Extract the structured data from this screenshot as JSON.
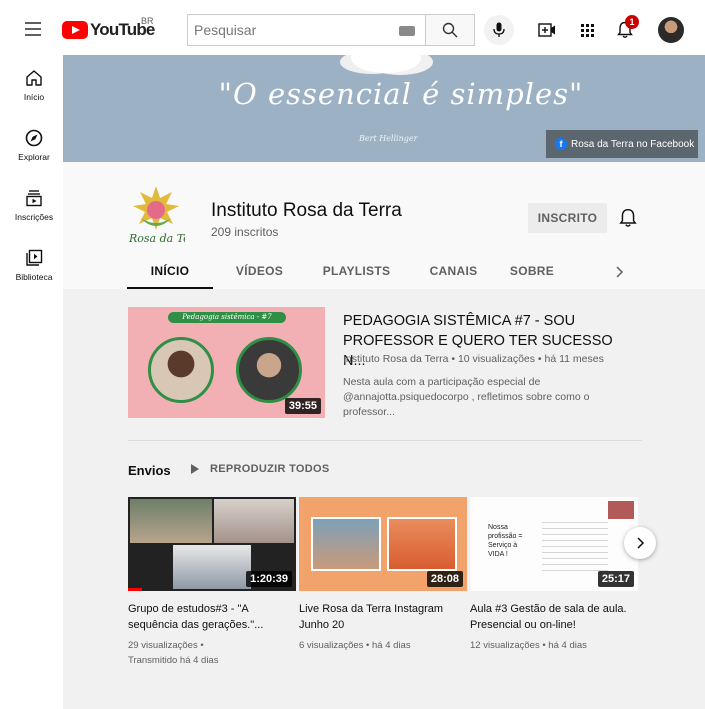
{
  "header": {
    "logo_text": "YouTube",
    "country_code": "BR",
    "search_placeholder": "Pesquisar",
    "notification_count": "1"
  },
  "sidebar": {
    "items": [
      {
        "label": "Início",
        "icon": "home-icon"
      },
      {
        "label": "Explorar",
        "icon": "compass-icon"
      },
      {
        "label": "Inscrições",
        "icon": "subscriptions-icon"
      },
      {
        "label": "Biblioteca",
        "icon": "library-icon"
      }
    ]
  },
  "banner": {
    "quote": "\"O essencial é simples\"",
    "author": "Bert Hellinger",
    "facebook_link": "Rosa da Terra no Facebook"
  },
  "channel": {
    "name": "Instituto Rosa da Terra",
    "subscribers": "209 inscritos",
    "subscribe_label": "INSCRITO",
    "logo_text": "Rosa da Terra"
  },
  "tabs": [
    {
      "label": "INÍCIO",
      "active": true
    },
    {
      "label": "VÍDEOS",
      "active": false
    },
    {
      "label": "PLAYLISTS",
      "active": false
    },
    {
      "label": "CANAIS",
      "active": false
    },
    {
      "label": "SOBRE",
      "active": false
    }
  ],
  "featured": {
    "thumb_banner": "Pedagogia sistêmica - #7",
    "duration": "39:55",
    "title": "PEDAGOGIA SISTÊMICA #7 - SOU PROFESSOR E QUERO TER SUCESSO N...",
    "meta": "Instituto Rosa da Terra • 10 visualizações • há 11 meses",
    "description": "Nesta aula com a participação especial de @annajotta.psiquedocorpo , refletimos sobre como o professor..."
  },
  "shelf": {
    "title": "Envios",
    "play_all": "REPRODUZIR TODOS",
    "videos": [
      {
        "title": "Grupo de estudos#3 - \"A sequência das gerações.\"...",
        "meta1": "29 visualizações •",
        "meta2": "Transmitido há 4 dias",
        "duration": "1:20:39"
      },
      {
        "title": "Live Rosa da Terra Instagram Junho 20",
        "meta1": "6 visualizações • há 4 dias",
        "meta2": "",
        "duration": "28:08"
      },
      {
        "title": "Aula #3 Gestão de sala de aula. Presencial ou on-line!",
        "meta1": "12 visualizações • há 4 dias",
        "meta2": "",
        "duration": "25:17",
        "slide_text": "Nossa profissão = Serviço à VIDA !"
      }
    ]
  },
  "colors": {
    "brand_red": "#ff0000",
    "banner_bg": "#9cb1c3",
    "facebook_blue": "#1877f2"
  }
}
